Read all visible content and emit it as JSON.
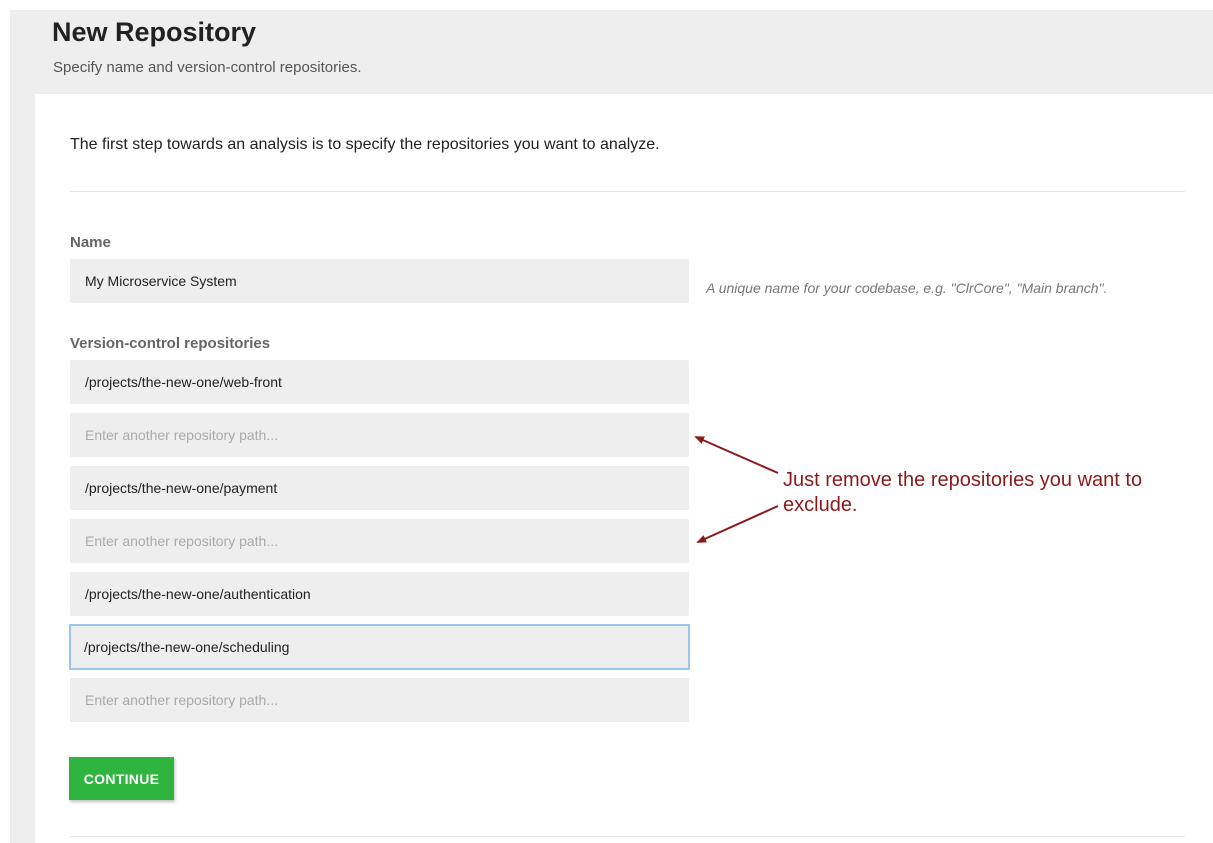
{
  "header": {
    "title": "New Repository",
    "subtitle": "Specify name and version-control repositories."
  },
  "intro": "The first step towards an analysis is to specify the repositories you want to analyze.",
  "name_field": {
    "label": "Name",
    "value": "My Microservice System",
    "hint": "A unique name for your codebase, e.g. \"ClrCore\", \"Main branch\"."
  },
  "repositories": {
    "label": "Version-control repositories",
    "placeholder": "Enter another repository path...",
    "items": [
      {
        "value": "/projects/the-new-one/web-front"
      },
      {
        "value": ""
      },
      {
        "value": "/projects/the-new-one/payment"
      },
      {
        "value": ""
      },
      {
        "value": "/projects/the-new-one/authentication"
      },
      {
        "value": "/projects/the-new-one/scheduling"
      },
      {
        "value": ""
      }
    ]
  },
  "continue_label": "CONTINUE",
  "annotation": {
    "text": "Just remove the repositories you want to exclude.",
    "color": "#8b1a1a"
  },
  "colors": {
    "accent_button": "#2fb440",
    "focus_border": "#9cc4ef",
    "field_background": "#eeeeee"
  }
}
